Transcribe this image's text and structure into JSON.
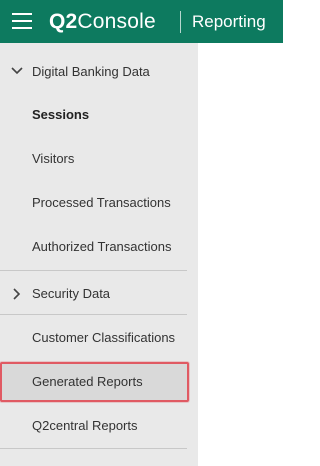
{
  "header": {
    "logo_q2": "Q2",
    "logo_console": "Console",
    "section_title": "Reporting"
  },
  "sidebar": {
    "items": [
      {
        "label": "Digital Banking Data",
        "expanded": true
      },
      {
        "label": "Sessions",
        "selected": true
      },
      {
        "label": "Visitors"
      },
      {
        "label": "Processed Transactions"
      },
      {
        "label": "Authorized Transactions"
      },
      {
        "label": "Security Data",
        "expanded": false
      },
      {
        "label": "Customer Classifications"
      },
      {
        "label": "Generated Reports",
        "highlighted": true
      },
      {
        "label": "Q2central Reports"
      }
    ]
  },
  "colors": {
    "header_bg": "#0d7a5f",
    "sidebar_bg": "#e9e9e9",
    "highlight_border": "#e05a63"
  }
}
